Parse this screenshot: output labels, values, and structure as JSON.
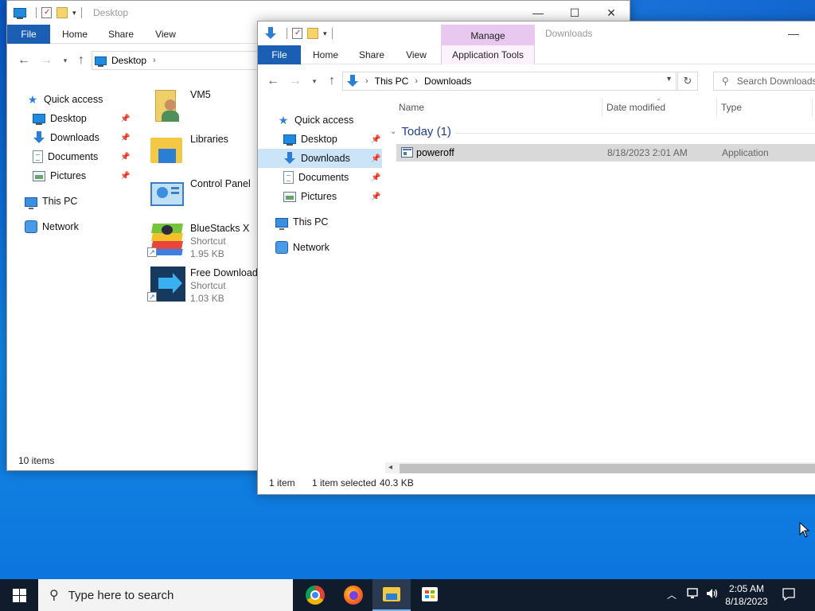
{
  "desktop_window": {
    "title": "Desktop",
    "tabs": {
      "file": "File",
      "home": "Home",
      "share": "Share",
      "view": "View"
    },
    "address": {
      "location": "Desktop"
    },
    "nav": {
      "quick_access": "Quick access",
      "desktop": "Desktop",
      "downloads": "Downloads",
      "documents": "Documents",
      "pictures": "Pictures",
      "this_pc": "This PC",
      "network": "Network"
    },
    "items": [
      {
        "name": "VM5",
        "type": "",
        "size": ""
      },
      {
        "name": "Libraries",
        "type": "",
        "size": ""
      },
      {
        "name": "Control Panel",
        "type": "",
        "size": ""
      },
      {
        "name": "BlueStacks X",
        "type": "Shortcut",
        "size": "1.95 KB"
      },
      {
        "name": "Free Download I",
        "type": "Shortcut",
        "size": "1.03 KB"
      }
    ],
    "status": "10 items"
  },
  "downloads_window": {
    "title": "Downloads",
    "context_tab": "Manage",
    "context_sub": "Application Tools",
    "tabs": {
      "file": "File",
      "home": "Home",
      "share": "Share",
      "view": "View"
    },
    "address": {
      "root": "This PC",
      "current": "Downloads"
    },
    "search_placeholder": "Search Downloads",
    "nav": {
      "quick_access": "Quick access",
      "desktop": "Desktop",
      "downloads": "Downloads",
      "documents": "Documents",
      "pictures": "Pictures",
      "this_pc": "This PC",
      "network": "Network"
    },
    "columns": {
      "name": "Name",
      "date": "Date modified",
      "type": "Type"
    },
    "group": "Today (1)",
    "files": [
      {
        "name": "poweroff",
        "date": "8/18/2023 2:01 AM",
        "type": "Application"
      }
    ],
    "status": {
      "count": "1 item",
      "selected": "1 item selected",
      "size": "40.3 KB"
    }
  },
  "taskbar": {
    "search_placeholder": "Type here to search",
    "time": "2:05 AM",
    "date": "8/18/2023"
  },
  "colors": {
    "file_tab": "#1a5fb4",
    "manage_tab": "#e9c8f0",
    "selection": "#cce4f7",
    "taskbar": "#101c2c"
  }
}
